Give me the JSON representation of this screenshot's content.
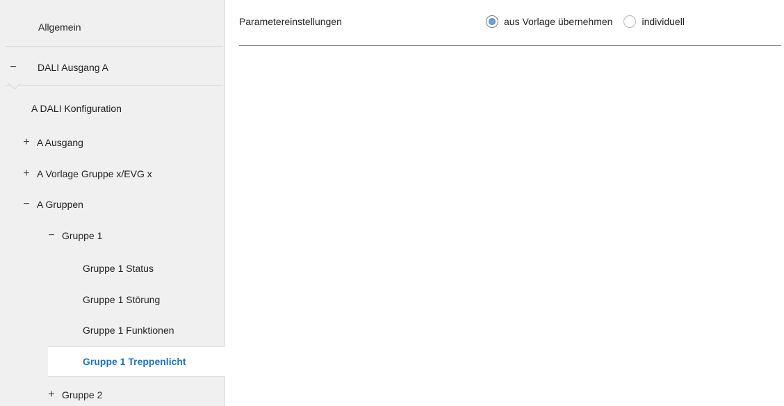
{
  "sidebar": {
    "items": [
      {
        "label": "Allgemein",
        "sign": ""
      },
      {
        "label": "DALI Ausgang A",
        "sign": "−"
      },
      {
        "label": "A DALI Konfiguration",
        "sign": ""
      },
      {
        "label": "A Ausgang",
        "sign": "+"
      },
      {
        "label": "A Vorlage Gruppe x/EVG x",
        "sign": "+"
      },
      {
        "label": "A Gruppen",
        "sign": "−"
      },
      {
        "label": "Gruppe 1",
        "sign": "−"
      },
      {
        "label": "Gruppe 1 Status",
        "sign": ""
      },
      {
        "label": "Gruppe 1 Störung",
        "sign": ""
      },
      {
        "label": "Gruppe 1 Funktionen",
        "sign": ""
      },
      {
        "label": "Gruppe 1 Treppenlicht",
        "sign": "",
        "selected": true
      },
      {
        "label": "Gruppe 2",
        "sign": "+"
      }
    ]
  },
  "main": {
    "param_label": "Parametereinstellungen",
    "options": [
      {
        "label": "aus Vorlage übernehmen",
        "checked": true
      },
      {
        "label": "individuell",
        "checked": false
      }
    ]
  },
  "colors": {
    "selected_text": "#1a73c2",
    "radio_fill": "#6f9fd0",
    "sidebar_bg": "#f0f0f0"
  }
}
